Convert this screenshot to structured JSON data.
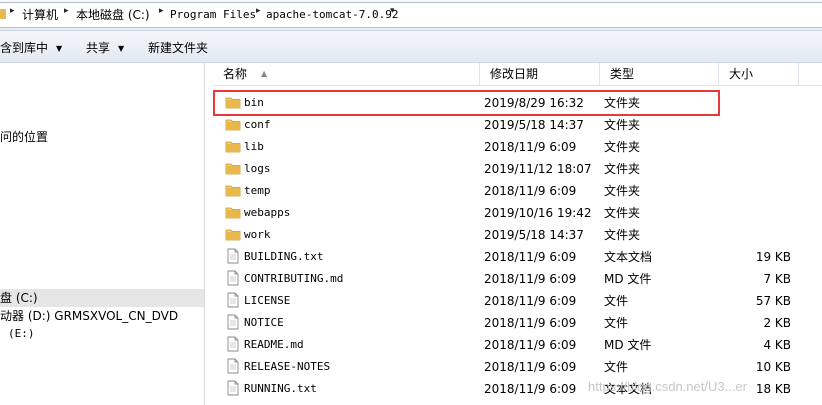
{
  "address": {
    "crumbs": [
      "计算机",
      "本地磁盘 (C:)",
      "Program Files",
      "apache-tomcat-7.0.92"
    ]
  },
  "toolbar": {
    "include_in_library": "含到库中",
    "share": "共享",
    "new_folder": "新建文件夹"
  },
  "nav": {
    "recent_places": "问的位置",
    "local_disk": "盘 (C:)",
    "dvd_drive": "动器 (D:) GRMSXVOL_CN_DVD",
    "drive_e": "(E:)"
  },
  "columns": {
    "name": "名称",
    "date": "修改日期",
    "type": "类型",
    "size": "大小"
  },
  "files": [
    {
      "name": "bin",
      "date": "2019/8/29 16:32",
      "type": "文件夹",
      "size": "",
      "kind": "folder-icon"
    },
    {
      "name": "conf",
      "date": "2019/5/18 14:37",
      "type": "文件夹",
      "size": "",
      "kind": "folder-icon"
    },
    {
      "name": "lib",
      "date": "2018/11/9 6:09",
      "type": "文件夹",
      "size": "",
      "kind": "folder-icon"
    },
    {
      "name": "logs",
      "date": "2019/11/12 18:07",
      "type": "文件夹",
      "size": "",
      "kind": "folder-icon"
    },
    {
      "name": "temp",
      "date": "2018/11/9 6:09",
      "type": "文件夹",
      "size": "",
      "kind": "folder-icon"
    },
    {
      "name": "webapps",
      "date": "2019/10/16 19:42",
      "type": "文件夹",
      "size": "",
      "kind": "folder-icon"
    },
    {
      "name": "work",
      "date": "2019/5/18 14:37",
      "type": "文件夹",
      "size": "",
      "kind": "folder-icon"
    },
    {
      "name": "BUILDING.txt",
      "date": "2018/11/9 6:09",
      "type": "文本文档",
      "size": "19 KB",
      "kind": "document-icon"
    },
    {
      "name": "CONTRIBUTING.md",
      "date": "2018/11/9 6:09",
      "type": "MD 文件",
      "size": "7 KB",
      "kind": "document-icon"
    },
    {
      "name": "LICENSE",
      "date": "2018/11/9 6:09",
      "type": "文件",
      "size": "57 KB",
      "kind": "document-icon"
    },
    {
      "name": "NOTICE",
      "date": "2018/11/9 6:09",
      "type": "文件",
      "size": "2 KB",
      "kind": "document-icon"
    },
    {
      "name": "README.md",
      "date": "2018/11/9 6:09",
      "type": "MD 文件",
      "size": "4 KB",
      "kind": "document-icon"
    },
    {
      "name": "RELEASE-NOTES",
      "date": "2018/11/9 6:09",
      "type": "文件",
      "size": "10 KB",
      "kind": "document-icon"
    },
    {
      "name": "RUNNING.txt",
      "date": "2018/11/9 6:09",
      "type": "文本文档",
      "size": "18 KB",
      "kind": "document-icon"
    }
  ],
  "watermark": "https://blog.csdn.net/U3...er",
  "colors": {
    "highlight": "#e8383b",
    "folder": "#e7b94a"
  }
}
